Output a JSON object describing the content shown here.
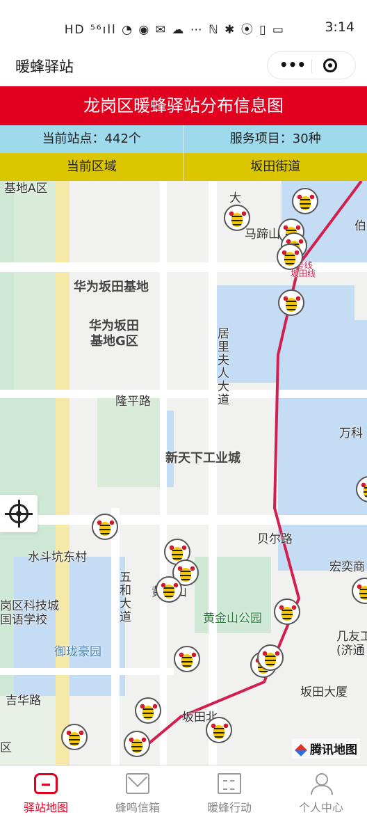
{
  "status": {
    "icons": "HD ⁵⁶ıll ◔ ◉ ✉ ☁ ⋯ ℕ ✱ ⦿ ▯ ▭",
    "time": "3:14"
  },
  "app": {
    "title": "暖蜂驿站"
  },
  "banner": {
    "title": "龙岗区暖蜂驿站分布信息图"
  },
  "stats": {
    "stations": "当前站点：442个",
    "services": "服务项目：30种"
  },
  "region": {
    "label": "当前区域",
    "value": "坂田街道"
  },
  "map": {
    "pois": [
      "基地A区",
      "大",
      "马蹄山",
      "伯",
      "华为坂田基地",
      "华为坂田",
      "基地G区",
      "隆平路",
      "居里夫人大道",
      "万科",
      "新天下工业城",
      "贝尔路",
      "水斗坑东村",
      "宏奕商",
      "岗区科技城",
      "国语学校",
      "五和大道",
      "黄金山",
      "黄金山公园",
      "几友工",
      "(济通",
      "御珑豪园",
      "坂田大厦",
      "吉华路",
      "坂田北",
      "区",
      "5号线",
      "坂田线"
    ],
    "brand": "腾讯地图"
  },
  "tabs": [
    {
      "label": "驿站地图",
      "icon": "home-icon",
      "active": true
    },
    {
      "label": "蜂鸣信箱",
      "icon": "mail-icon",
      "active": false
    },
    {
      "label": "暖蜂行动",
      "icon": "action-icon",
      "active": false
    },
    {
      "label": "个人中心",
      "icon": "user-icon",
      "active": false
    }
  ],
  "colors": {
    "banner": "#e2001f",
    "stats_bg": "#9fd9ec",
    "region_bg": "#dcc600",
    "tab_active": "#e2001f"
  }
}
